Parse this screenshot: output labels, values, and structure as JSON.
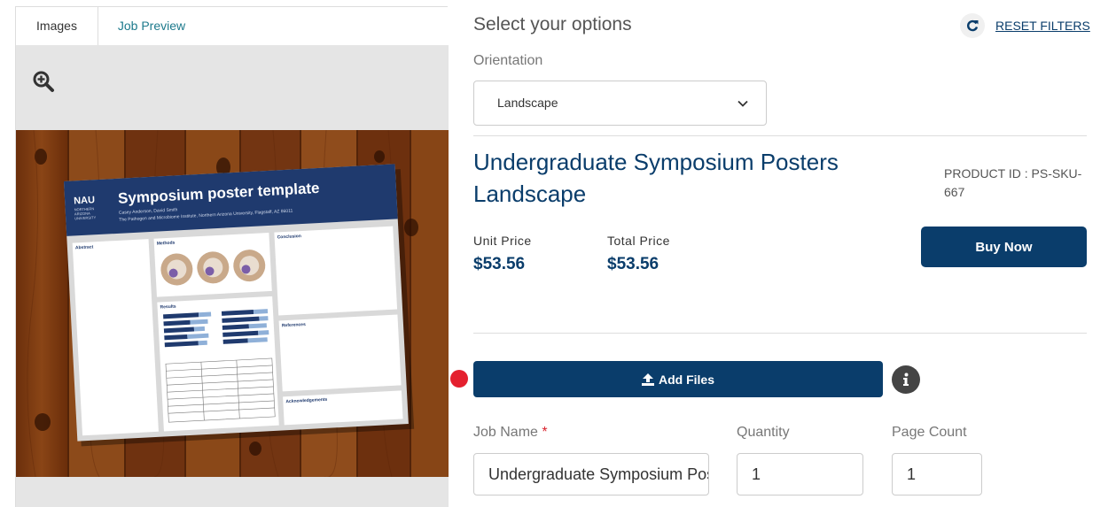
{
  "tabs": {
    "images": "Images",
    "job_preview": "Job Preview"
  },
  "preview": {
    "poster_title": "Symposium poster template",
    "poster_logo": "NAU",
    "poster_authors": "Casey Anderson, David Smith",
    "poster_affiliation": "The Pathogen and Microbiome Institute, Northern Arizona University, Flagstaff, AZ 86011",
    "sections": [
      "Abstract",
      "Methods",
      "Conclusion",
      "Results",
      "References",
      "Acknowledgements"
    ]
  },
  "options": {
    "heading": "Select your options",
    "reset_label": "RESET FILTERS",
    "orientation_label": "Orientation",
    "orientation_value": "Landscape"
  },
  "product": {
    "title": "Undergraduate Symposium Posters Landscape",
    "id_label": "PRODUCT ID : PS-SKU-667",
    "unit_price_label": "Unit Price",
    "unit_price": "$53.56",
    "total_price_label": "Total Price",
    "total_price": "$53.56",
    "buy_label": "Buy Now"
  },
  "upload": {
    "add_files_label": "Add Files"
  },
  "job": {
    "name_label": "Job Name",
    "required_mark": "*",
    "name_value": "Undergraduate Symposium Posters Landscape",
    "quantity_label": "Quantity",
    "quantity_value": "1",
    "page_count_label": "Page Count",
    "page_count_value": "1"
  },
  "colors": {
    "brand": "#0a3d6b",
    "required": "#d9232e",
    "tab_link": "#1d7a8c"
  }
}
